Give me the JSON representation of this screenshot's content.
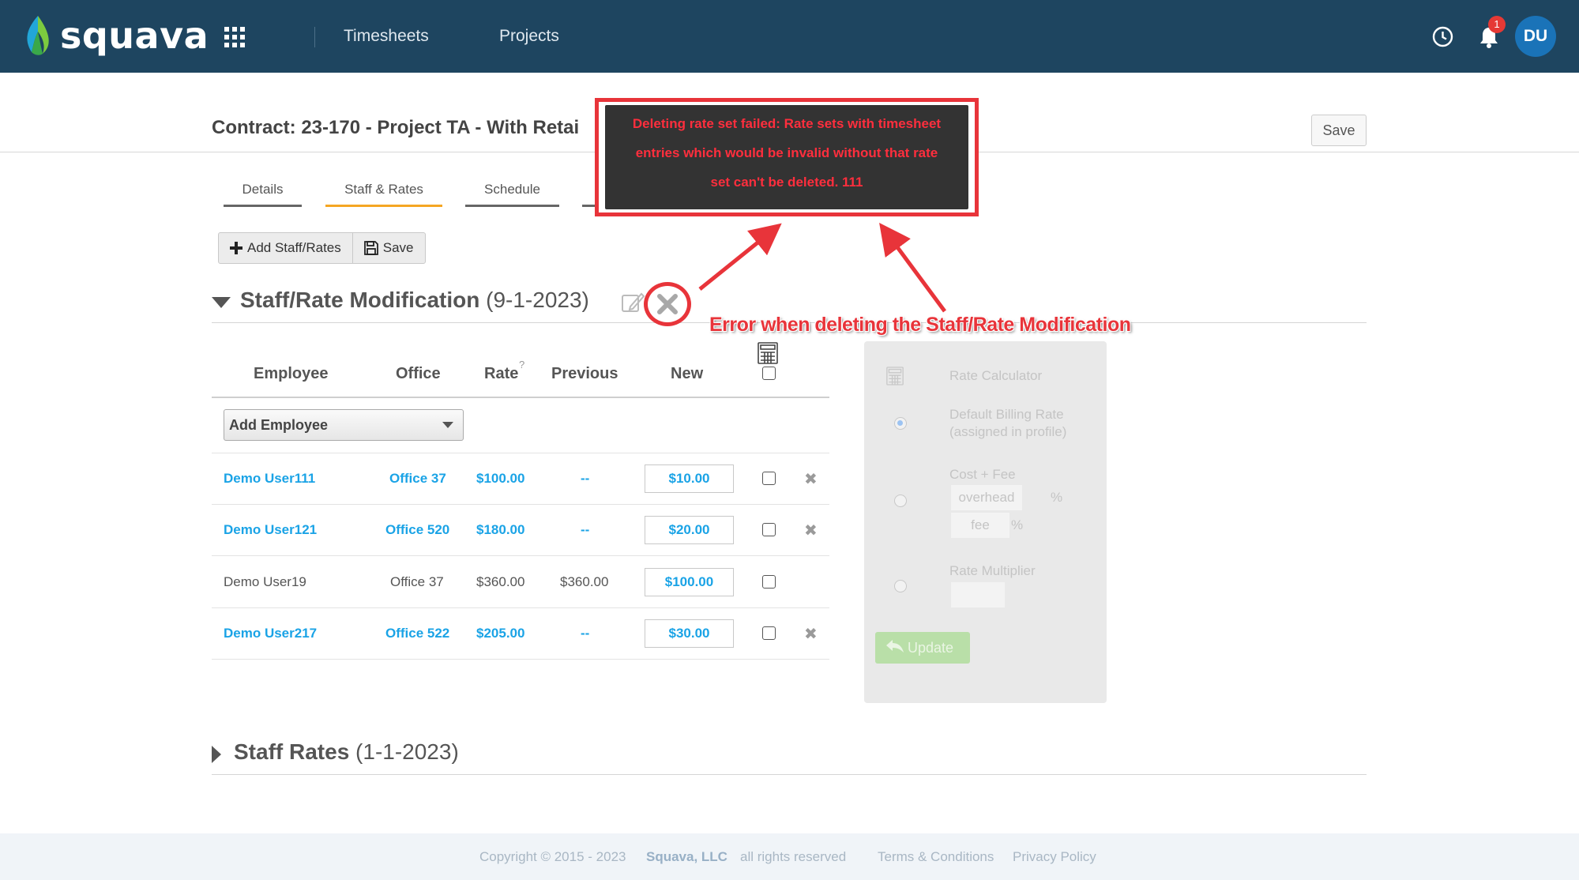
{
  "app": {
    "brand": "squava",
    "nav": [
      "Timesheets",
      "Projects"
    ],
    "notification_count": "1",
    "user_initials": "DU"
  },
  "header": {
    "contract_title": "Contract: 23-170 - Project TA - With Retai",
    "save_label": "Save"
  },
  "tabs": [
    {
      "label": "Details",
      "active": false
    },
    {
      "label": "Staff & Rates",
      "active": true
    },
    {
      "label": "Schedule",
      "active": false
    }
  ],
  "toolbar": {
    "add_label": "Add Staff/Rates",
    "save_label": "Save"
  },
  "modification": {
    "title": "Staff/Rate Modification",
    "date": "(9-1-2023)",
    "columns": [
      "Employee",
      "Office",
      "Rate",
      "Previous",
      "New"
    ],
    "rate_hint": "?",
    "add_employee": "Add Employee",
    "rows": [
      {
        "employee": "Demo User111",
        "office": "Office 37",
        "rate": "$100.00",
        "previous": "--",
        "new": "$10.00",
        "highlight": true,
        "removable": true
      },
      {
        "employee": "Demo User121",
        "office": "Office 520",
        "rate": "$180.00",
        "previous": "--",
        "new": "$20.00",
        "highlight": true,
        "removable": true
      },
      {
        "employee": "Demo User19",
        "office": "Office 37",
        "rate": "$360.00",
        "previous": "$360.00",
        "new": "$100.00",
        "highlight": false,
        "removable": false
      },
      {
        "employee": "Demo User217",
        "office": "Office 522",
        "rate": "$205.00",
        "previous": "--",
        "new": "$30.00",
        "highlight": true,
        "removable": true
      }
    ]
  },
  "calculator": {
    "title": "Rate Calculator",
    "default_rate_line1": "Default Billing Rate",
    "default_rate_line2": "(assigned in profile)",
    "cost_fee": "Cost + Fee",
    "overhead_placeholder": "overhead",
    "fee_placeholder": "fee",
    "percent": "%",
    "multiplier": "Rate Multiplier",
    "update_label": "Update"
  },
  "staff_rates": {
    "title": "Staff Rates",
    "date": "(1-1-2023)"
  },
  "error": {
    "message_line1": "Deleting rate set failed: Rate sets with timesheet",
    "message_line2": "entries which would be invalid without that rate",
    "message_line3": "set can't be deleted. 111",
    "annotation": "Error when deleting the Staff/Rate Modification"
  },
  "footer": {
    "copyright": "Copyright © 2015 - 2023",
    "company": "Squava, LLC",
    "rights": "all rights reserved",
    "terms": "Terms & Conditions",
    "privacy": "Privacy Policy"
  },
  "colors": {
    "navbar": "#1e4560",
    "link": "#1aa3e6",
    "active_tab": "#f5a623",
    "error": "#e8343a"
  }
}
